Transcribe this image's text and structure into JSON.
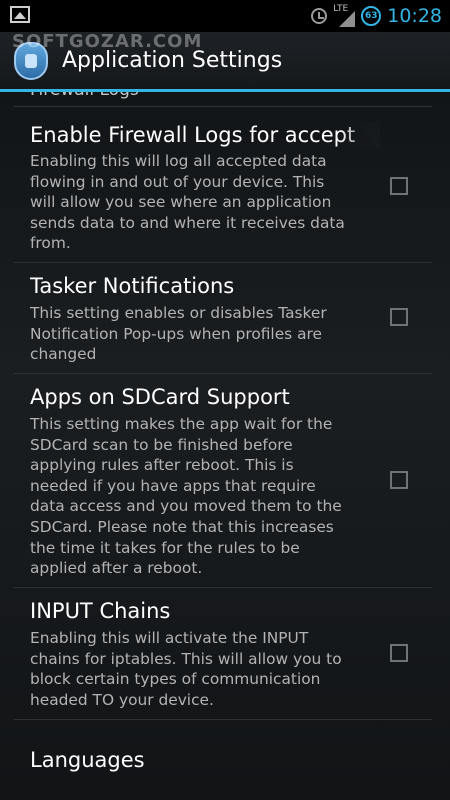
{
  "status_bar": {
    "network_label": "LTE",
    "battery_level": "63",
    "time": "10:28",
    "accent_color": "#33b5e5"
  },
  "action_bar": {
    "title": "Application Settings",
    "watermark": "SOFTGOZAR.COM",
    "icon": "firewall-shield-icon"
  },
  "settings": {
    "partial_category": "Firewall Logs",
    "items": [
      {
        "title": "Enable Firewall Logs for accept",
        "summary": "Enabling this will log all accepted data flowing in and out of your device. This will allow you see where an application sends data to and where it receives data from.",
        "checked": false
      },
      {
        "title": "Tasker Notifications",
        "summary": "This setting enables or disables Tasker Notification Pop-ups when profiles are changed",
        "checked": false
      },
      {
        "title": "Apps on SDCard Support",
        "summary": "This setting makes the app wait for the SDCard scan to be finished before applying rules after reboot. This is needed if you have apps that require data access and you moved them to the SDCard. Please note that this increases the time it takes for the rules to be applied after a reboot.",
        "checked": false
      },
      {
        "title": "INPUT Chains",
        "summary": "Enabling this will activate the INPUT chains for iptables. This will allow you to block certain types of communication headed TO your device.",
        "checked": false
      }
    ],
    "languages_label": "Languages"
  }
}
